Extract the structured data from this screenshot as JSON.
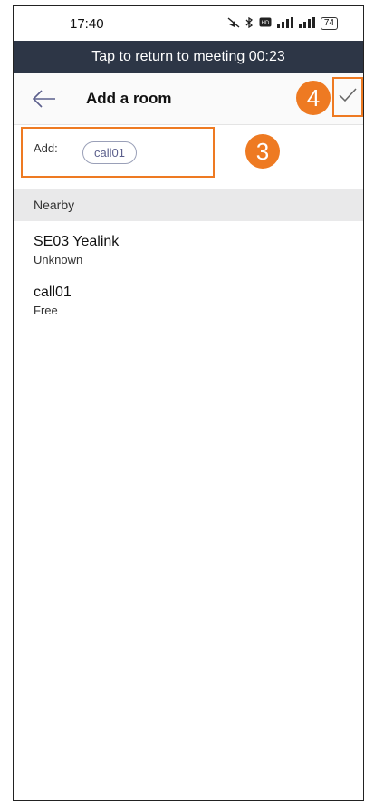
{
  "status_bar": {
    "time": "17:40",
    "battery": "74",
    "icons": [
      "mute-icon",
      "bluetooth-icon",
      "hd-icon",
      "signal-icon",
      "signal-icon"
    ]
  },
  "banner": {
    "text": "Tap to return to meeting 00:23"
  },
  "header": {
    "title": "Add a room"
  },
  "annotations": {
    "step_confirm": "4",
    "step_add": "3",
    "color": "#ee7a22"
  },
  "add": {
    "label": "Add:",
    "chip": "call01"
  },
  "nearby": {
    "heading": "Nearby",
    "rooms": [
      {
        "name": "SE03 Yealink",
        "status": "Unknown"
      },
      {
        "name": "call01",
        "status": "Free"
      }
    ]
  },
  "colors": {
    "banner_bg": "#2d3646",
    "accent": "#ee7a22",
    "section_bg": "#e9e9ea"
  }
}
